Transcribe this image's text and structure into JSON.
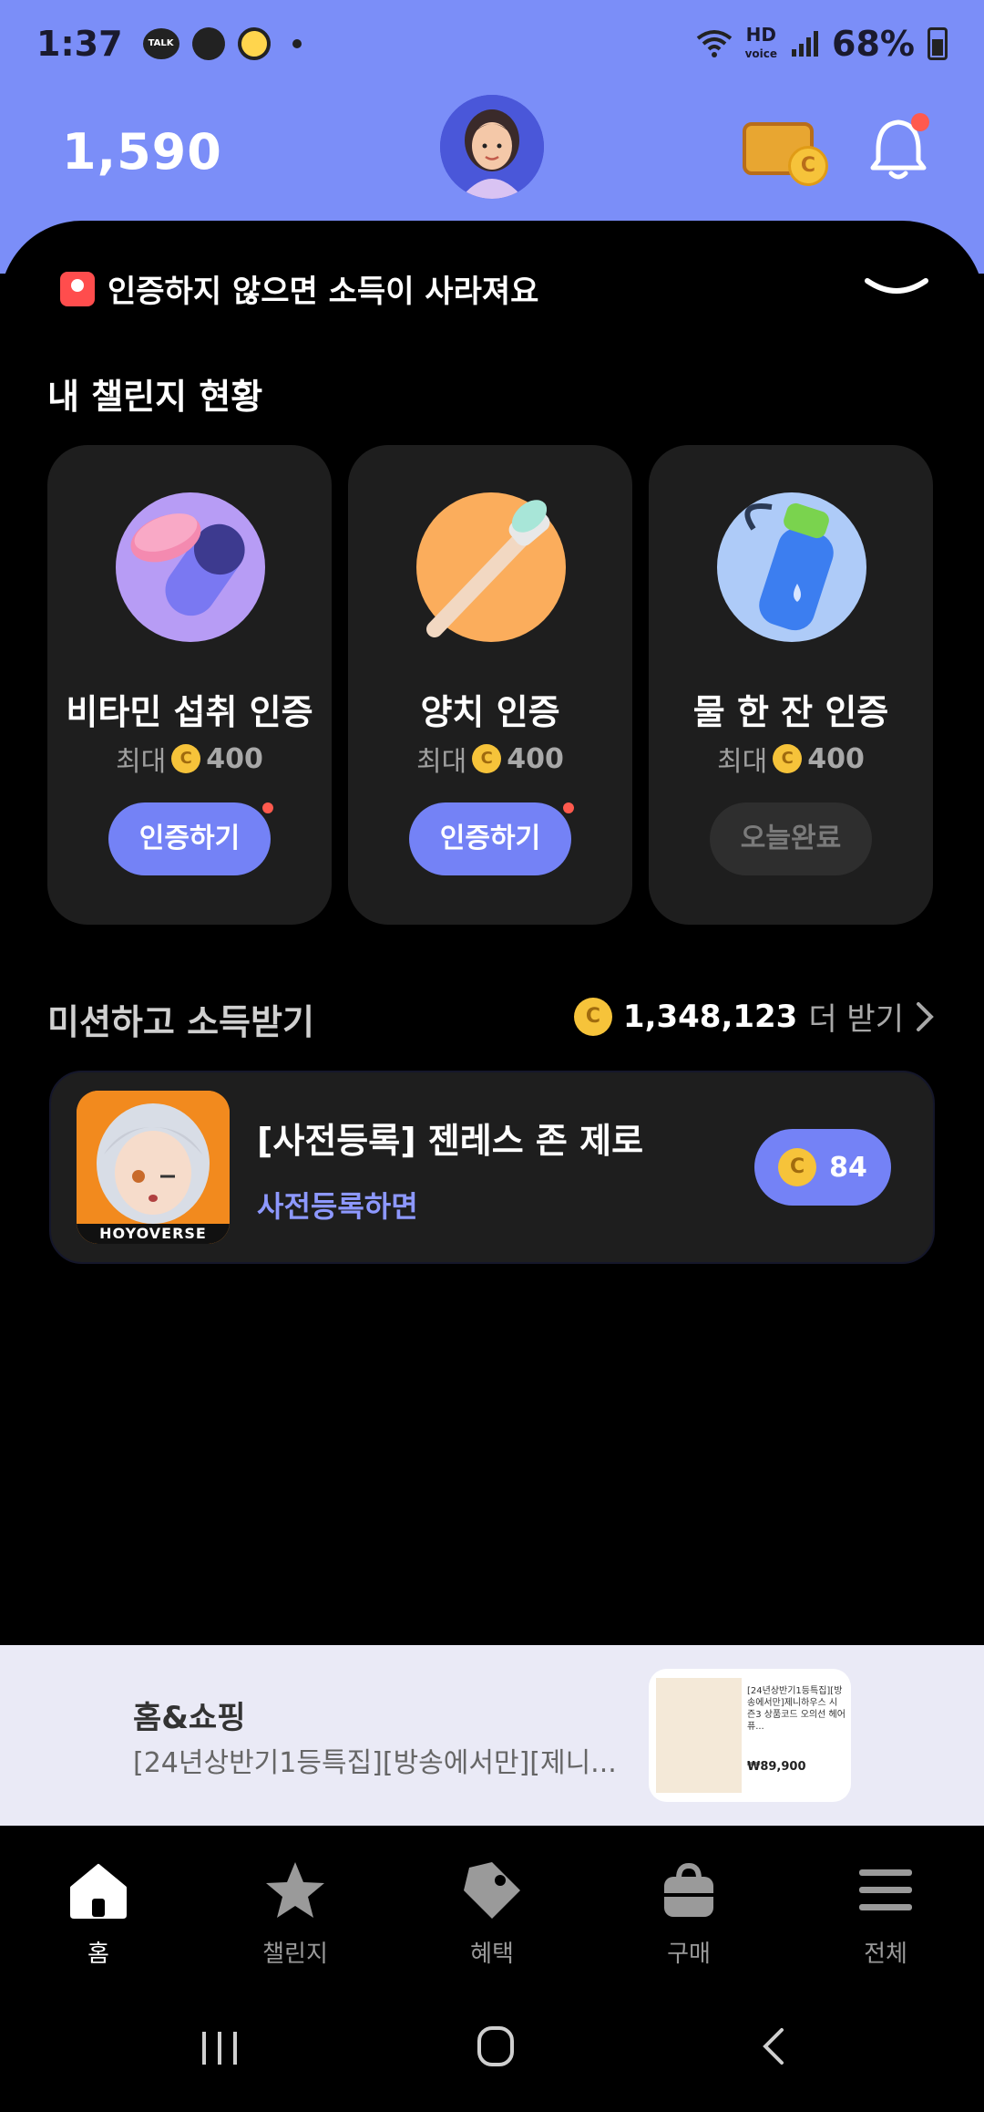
{
  "status_bar": {
    "time": "1:37",
    "talk_badge": "TALK",
    "hd_label": "HD",
    "voice_label": "voice",
    "battery": "68%"
  },
  "header": {
    "points": "1,590"
  },
  "alert": {
    "text": "인증하지 않으면 소득이 사라져요"
  },
  "challenges": {
    "title": "내 챌린지 현황",
    "cards": [
      {
        "title": "비타민 섭취 인증",
        "reward_prefix": "최대",
        "reward": "400",
        "button": "인증하기",
        "status": "active"
      },
      {
        "title": "양치 인증",
        "reward_prefix": "최대",
        "reward": "400",
        "button": "인증하기",
        "status": "active"
      },
      {
        "title": "물 한 잔 인증",
        "reward_prefix": "최대",
        "reward": "400",
        "button": "오늘완료",
        "status": "done"
      }
    ]
  },
  "missions": {
    "title": "미션하고 소득받기",
    "total": "1,348,123",
    "more_label": "더 받기",
    "items": [
      {
        "name": "[사전등록] 젠레스 존 제로",
        "subtitle": "사전등록하면",
        "reward": "84",
        "brand": "HOYOVERSE"
      }
    ]
  },
  "ad": {
    "title": "홈&쇼핑",
    "description": "[24년상반기1등특집][방송에서만][제니...",
    "thumb_text": "[24년상반기1등특집][방송에서만]제니하우스 시즌3 상품코드 오의선 헤어퓨...",
    "thumb_price": "₩89,900"
  },
  "coin_symbol": "C",
  "bottom_nav": [
    {
      "label": "홈",
      "icon": "home-icon",
      "active": true
    },
    {
      "label": "챌린지",
      "icon": "star-icon",
      "active": false
    },
    {
      "label": "혜택",
      "icon": "tag-icon",
      "active": false
    },
    {
      "label": "구매",
      "icon": "bag-icon",
      "active": false
    },
    {
      "label": "전체",
      "icon": "menu-icon",
      "active": false
    }
  ],
  "colors": {
    "accent": "#7b8ef8",
    "button": "#7482f6",
    "coin": "#f6c33a",
    "notification": "#ff5a4e"
  }
}
